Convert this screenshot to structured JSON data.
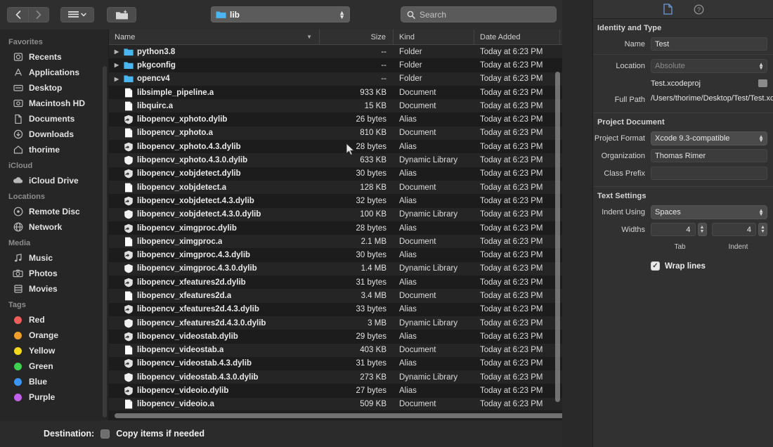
{
  "window": {
    "toolbar": {
      "back_label": "‹",
      "forward_label": "›",
      "view_label": "view-options",
      "newfolder_label": "new-folder",
      "path_popup_value": "lib",
      "search_placeholder": "Search"
    },
    "bottom": {
      "destination_label": "Destination:",
      "copy_items_label": "Copy items if needed"
    }
  },
  "sidebar": {
    "sections": [
      {
        "title": "Favorites",
        "items": [
          {
            "label": "Recents",
            "icon": "clock-icon"
          },
          {
            "label": "Applications",
            "icon": "applications-icon"
          },
          {
            "label": "Desktop",
            "icon": "desktop-icon"
          },
          {
            "label": "Macintosh HD",
            "icon": "harddisk-icon"
          },
          {
            "label": "Documents",
            "icon": "documents-icon"
          },
          {
            "label": "Downloads",
            "icon": "downloads-icon"
          },
          {
            "label": "thorime",
            "icon": "home-icon"
          }
        ]
      },
      {
        "title": "iCloud",
        "items": [
          {
            "label": "iCloud Drive",
            "icon": "cloud-icon"
          }
        ]
      },
      {
        "title": "Locations",
        "items": [
          {
            "label": "Remote Disc",
            "icon": "disc-icon"
          },
          {
            "label": "Network",
            "icon": "network-icon"
          }
        ]
      },
      {
        "title": "Media",
        "items": [
          {
            "label": "Music",
            "icon": "music-note-icon"
          },
          {
            "label": "Photos",
            "icon": "camera-icon"
          },
          {
            "label": "Movies",
            "icon": "film-icon"
          }
        ]
      },
      {
        "title": "Tags",
        "items": [
          {
            "label": "Red",
            "icon": "tag-dot-icon",
            "color": "#ec5f5b"
          },
          {
            "label": "Orange",
            "icon": "tag-dot-icon",
            "color": "#f0a02a"
          },
          {
            "label": "Yellow",
            "icon": "tag-dot-icon",
            "color": "#f3d71f"
          },
          {
            "label": "Green",
            "icon": "tag-dot-icon",
            "color": "#3ed14f"
          },
          {
            "label": "Blue",
            "icon": "tag-dot-icon",
            "color": "#3b95f4"
          },
          {
            "label": "Purple",
            "icon": "tag-dot-icon",
            "color": "#c160e8"
          }
        ]
      }
    ]
  },
  "filelist": {
    "columns": [
      "Name",
      "Size",
      "Kind",
      "Date Added"
    ],
    "sort_column": "Name",
    "rows": [
      {
        "name": "python3.8",
        "size": "--",
        "kind": "Folder",
        "date": "Today at 6:23 PM",
        "icon": "folder-icon",
        "expandable": true
      },
      {
        "name": "pkgconfig",
        "size": "--",
        "kind": "Folder",
        "date": "Today at 6:23 PM",
        "icon": "folder-icon",
        "expandable": true
      },
      {
        "name": "opencv4",
        "size": "--",
        "kind": "Folder",
        "date": "Today at 6:23 PM",
        "icon": "folder-icon",
        "expandable": true
      },
      {
        "name": "libsimple_pipeline.a",
        "size": "933 KB",
        "kind": "Document",
        "date": "Today at 6:23 PM",
        "icon": "document-icon",
        "expandable": false
      },
      {
        "name": "libquirc.a",
        "size": "15 KB",
        "kind": "Document",
        "date": "Today at 6:23 PM",
        "icon": "document-icon",
        "expandable": false
      },
      {
        "name": "libopencv_xphoto.dylib",
        "size": "26 bytes",
        "kind": "Alias",
        "date": "Today at 6:23 PM",
        "icon": "alias-icon",
        "expandable": false
      },
      {
        "name": "libopencv_xphoto.a",
        "size": "810 KB",
        "kind": "Document",
        "date": "Today at 6:23 PM",
        "icon": "document-icon",
        "expandable": false
      },
      {
        "name": "libopencv_xphoto.4.3.dylib",
        "size": "28 bytes",
        "kind": "Alias",
        "date": "Today at 6:23 PM",
        "icon": "alias-icon",
        "expandable": false
      },
      {
        "name": "libopencv_xphoto.4.3.0.dylib",
        "size": "633 KB",
        "kind": "Dynamic Library",
        "date": "Today at 6:23 PM",
        "icon": "dylib-icon",
        "expandable": false
      },
      {
        "name": "libopencv_xobjdetect.dylib",
        "size": "30 bytes",
        "kind": "Alias",
        "date": "Today at 6:23 PM",
        "icon": "alias-icon",
        "expandable": false
      },
      {
        "name": "libopencv_xobjdetect.a",
        "size": "128 KB",
        "kind": "Document",
        "date": "Today at 6:23 PM",
        "icon": "document-icon",
        "expandable": false
      },
      {
        "name": "libopencv_xobjdetect.4.3.dylib",
        "size": "32 bytes",
        "kind": "Alias",
        "date": "Today at 6:23 PM",
        "icon": "alias-icon",
        "expandable": false
      },
      {
        "name": "libopencv_xobjdetect.4.3.0.dylib",
        "size": "100 KB",
        "kind": "Dynamic Library",
        "date": "Today at 6:23 PM",
        "icon": "dylib-icon",
        "expandable": false
      },
      {
        "name": "libopencv_ximgproc.dylib",
        "size": "28 bytes",
        "kind": "Alias",
        "date": "Today at 6:23 PM",
        "icon": "alias-icon",
        "expandable": false
      },
      {
        "name": "libopencv_ximgproc.a",
        "size": "2.1 MB",
        "kind": "Document",
        "date": "Today at 6:23 PM",
        "icon": "document-icon",
        "expandable": false
      },
      {
        "name": "libopencv_ximgproc.4.3.dylib",
        "size": "30 bytes",
        "kind": "Alias",
        "date": "Today at 6:23 PM",
        "icon": "alias-icon",
        "expandable": false
      },
      {
        "name": "libopencv_ximgproc.4.3.0.dylib",
        "size": "1.4 MB",
        "kind": "Dynamic Library",
        "date": "Today at 6:23 PM",
        "icon": "dylib-icon",
        "expandable": false
      },
      {
        "name": "libopencv_xfeatures2d.dylib",
        "size": "31 bytes",
        "kind": "Alias",
        "date": "Today at 6:23 PM",
        "icon": "alias-icon",
        "expandable": false
      },
      {
        "name": "libopencv_xfeatures2d.a",
        "size": "3.4 MB",
        "kind": "Document",
        "date": "Today at 6:23 PM",
        "icon": "document-icon",
        "expandable": false
      },
      {
        "name": "libopencv_xfeatures2d.4.3.dylib",
        "size": "33 bytes",
        "kind": "Alias",
        "date": "Today at 6:23 PM",
        "icon": "alias-icon",
        "expandable": false
      },
      {
        "name": "libopencv_xfeatures2d.4.3.0.dylib",
        "size": "3 MB",
        "kind": "Dynamic Library",
        "date": "Today at 6:23 PM",
        "icon": "dylib-icon",
        "expandable": false
      },
      {
        "name": "libopencv_videostab.dylib",
        "size": "29 bytes",
        "kind": "Alias",
        "date": "Today at 6:23 PM",
        "icon": "alias-icon",
        "expandable": false
      },
      {
        "name": "libopencv_videostab.a",
        "size": "403 KB",
        "kind": "Document",
        "date": "Today at 6:23 PM",
        "icon": "document-icon",
        "expandable": false
      },
      {
        "name": "libopencv_videostab.4.3.dylib",
        "size": "31 bytes",
        "kind": "Alias",
        "date": "Today at 6:23 PM",
        "icon": "alias-icon",
        "expandable": false
      },
      {
        "name": "libopencv_videostab.4.3.0.dylib",
        "size": "273 KB",
        "kind": "Dynamic Library",
        "date": "Today at 6:23 PM",
        "icon": "dylib-icon",
        "expandable": false
      },
      {
        "name": "libopencv_videoio.dylib",
        "size": "27 bytes",
        "kind": "Alias",
        "date": "Today at 6:23 PM",
        "icon": "alias-icon",
        "expandable": false
      },
      {
        "name": "libopencv_videoio.a",
        "size": "509 KB",
        "kind": "Document",
        "date": "Today at 6:23 PM",
        "icon": "document-icon",
        "expandable": false
      }
    ]
  },
  "inspector": {
    "tabs": [
      {
        "icon": "file-inspector-icon",
        "active": true
      },
      {
        "icon": "quick-help-icon",
        "active": false
      }
    ],
    "identity": {
      "section_title": "Identity and Type",
      "name_label": "Name",
      "name_value": "Test",
      "location_label": "Location",
      "location_value": "Absolute",
      "file_ref_value": "Test.xcodeproj",
      "fullpath_label": "Full Path",
      "fullpath_value": "/Users/thorime/Desktop/Test/Test.xcodeproj"
    },
    "project_document": {
      "section_title": "Project Document",
      "format_label": "Project Format",
      "format_value": "Xcode 9.3-compatible",
      "organization_label": "Organization",
      "organization_value": "Thomas Rimer",
      "class_prefix_label": "Class Prefix",
      "class_prefix_value": ""
    },
    "text_settings": {
      "section_title": "Text Settings",
      "indent_using_label": "Indent Using",
      "indent_using_value": "Spaces",
      "widths_label": "Widths",
      "tab_value": "4",
      "indent_value": "4",
      "tab_sublabel": "Tab",
      "indent_sublabel": "Indent",
      "wrap_lines_label": "Wrap lines",
      "wrap_lines_checked": true
    }
  }
}
